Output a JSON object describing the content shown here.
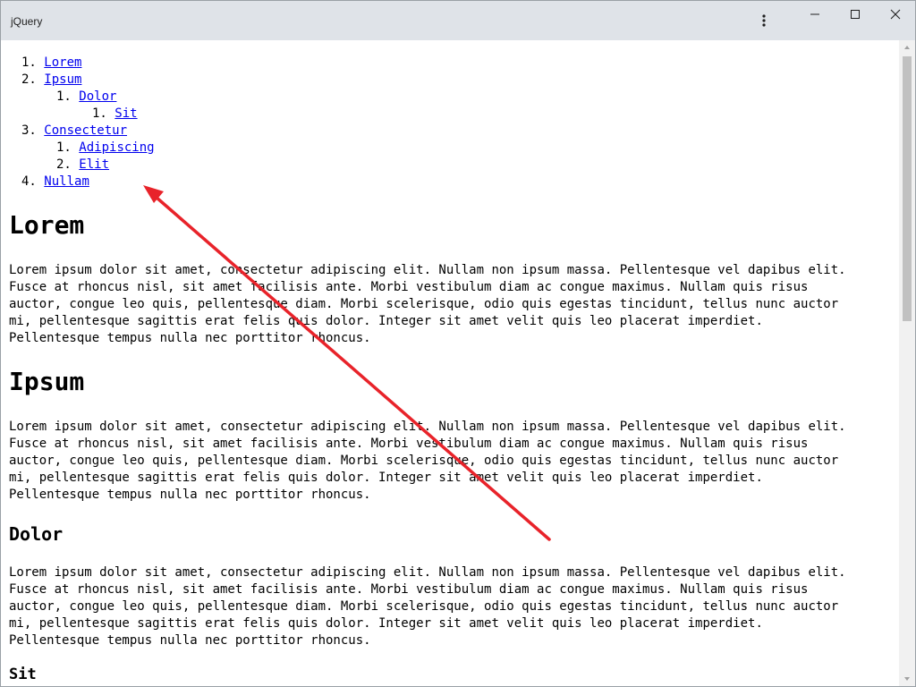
{
  "window": {
    "title": "jQuery"
  },
  "toc": {
    "items": [
      {
        "number": "1.",
        "label": "Lorem"
      },
      {
        "number": "2.",
        "label": "Ipsum"
      },
      {
        "number": "1.",
        "label": "Dolor"
      },
      {
        "number": "1.",
        "label": "Sit"
      },
      {
        "number": "3.",
        "label": "Consectetur"
      },
      {
        "number": "1.",
        "label": "Adipiscing"
      },
      {
        "number": "2.",
        "label": "Elit"
      },
      {
        "number": "4.",
        "label": "Nullam"
      }
    ]
  },
  "sections": [
    {
      "heading": "Lorem",
      "lines": [
        "Lorem ipsum dolor sit amet, consectetur adipiscing elit. Nullam non ipsum massa. Pellentesque vel dapibus elit.",
        "Fusce at rhoncus nisl, sit amet facilisis ante. Morbi vestibulum diam ac congue maximus. Nullam quis risus",
        "auctor, congue leo quis, pellentesque diam. Morbi scelerisque, odio quis egestas tincidunt, tellus nunc auctor",
        "mi, pellentesque sagittis erat felis quis dolor. Integer sit amet velit quis leo placerat imperdiet.",
        "Pellentesque tempus nulla nec porttitor rhoncus."
      ]
    },
    {
      "heading": "Ipsum",
      "lines": [
        "Lorem ipsum dolor sit amet, consectetur adipiscing elit. Nullam non ipsum massa. Pellentesque vel dapibus elit.",
        "Fusce at rhoncus nisl, sit amet facilisis ante. Morbi vestibulum diam ac congue maximus. Nullam quis risus",
        "auctor, congue leo quis, pellentesque diam. Morbi scelerisque, odio quis egestas tincidunt, tellus nunc auctor",
        "mi, pellentesque sagittis erat felis quis dolor. Integer sit amet velit quis leo placerat imperdiet.",
        "Pellentesque tempus nulla nec porttitor rhoncus."
      ]
    },
    {
      "heading": "Dolor",
      "lines": [
        "Lorem ipsum dolor sit amet, consectetur adipiscing elit. Nullam non ipsum massa. Pellentesque vel dapibus elit.",
        "Fusce at rhoncus nisl, sit amet facilisis ante. Morbi vestibulum diam ac congue maximus. Nullam quis risus",
        "auctor, congue leo quis, pellentesque diam. Morbi scelerisque, odio quis egestas tincidunt, tellus nunc auctor",
        "mi, pellentesque sagittis erat felis quis dolor. Integer sit amet velit quis leo placerat imperdiet.",
        "Pellentesque tempus nulla nec porttitor rhoncus."
      ]
    },
    {
      "heading": "Sit"
    }
  ],
  "colors": {
    "link": "#0000ee",
    "titlebar": "#dfe3e8",
    "annotation_arrow": "#e8232a"
  },
  "icons": {
    "menu": "vertical-ellipsis-icon",
    "minimize": "minimize-icon",
    "maximize": "maximize-icon",
    "close": "close-icon"
  }
}
